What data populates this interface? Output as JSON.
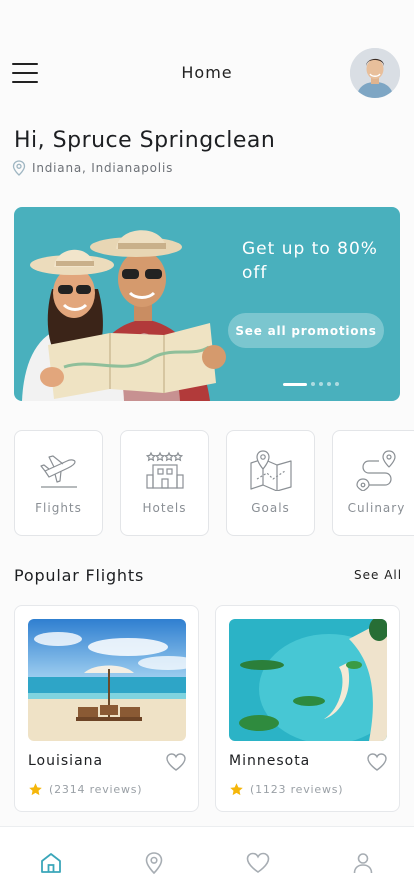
{
  "header": {
    "title": "Home",
    "menu_icon": "hamburger-menu-icon",
    "avatar": "user-avatar"
  },
  "greeting": {
    "text": "Hi, Spruce Springclean",
    "location": "Indiana, Indianapolis",
    "location_icon": "map-pin-icon"
  },
  "promo": {
    "headline": "Get up to 80% off",
    "button_label": "See all promotions",
    "slides_total": 5,
    "active_slide": 1,
    "background_color": "#49b0bd"
  },
  "categories": [
    {
      "label": "Flights",
      "icon": "airplane-icon"
    },
    {
      "label": "Hotels",
      "icon": "hotel-icon"
    },
    {
      "label": "Goals",
      "icon": "map-icon"
    },
    {
      "label": "Culinary",
      "icon": "route-icon"
    }
  ],
  "popular": {
    "title": "Popular Flights",
    "see_all": "See All",
    "items": [
      {
        "name": "Louisiana",
        "reviews": "(2314 reviews)",
        "rating_icon": "star-icon",
        "favorite_icon": "heart-icon"
      },
      {
        "name": "Minnesota",
        "reviews": "(1123 reviews)",
        "rating_icon": "star-icon",
        "favorite_icon": "heart-icon"
      }
    ]
  },
  "bottom_nav": [
    {
      "name": "home",
      "icon": "home-icon",
      "active": true
    },
    {
      "name": "location",
      "icon": "map-pin-icon",
      "active": false
    },
    {
      "name": "favorites",
      "icon": "heart-icon",
      "active": false
    },
    {
      "name": "profile",
      "icon": "user-icon",
      "active": false
    }
  ],
  "colors": {
    "accent": "#49b0bd",
    "star": "#f5b60a",
    "nav_active": "#3aa6b9"
  }
}
